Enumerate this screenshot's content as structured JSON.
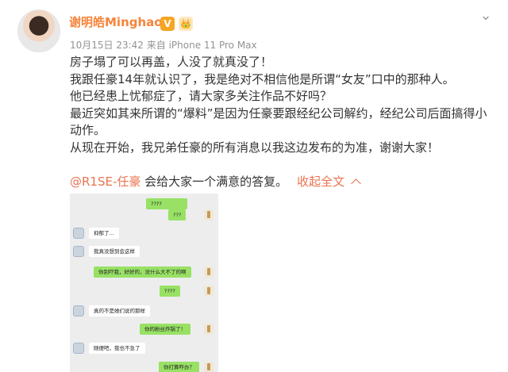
{
  "post": {
    "username": "谢明皓Minghao",
    "badges": [
      "V",
      "👑"
    ],
    "meta": "10月15日 23:42 来自 iPhone 11 Pro Max",
    "lines": [
      "房子塌了可以再盖，人没了就真没了！",
      "我跟任豪14年就认识了，我是绝对不相信他是所谓“女友”口中的那种人。",
      "他已经患上忧郁症了，请大家多关注作品不好吗？",
      "最近突如其来所谓的“爆料”是因为任豪要跟经纪公司解约，经纪公司后面搞得小",
      "动作。",
      "从现在开始，我兄弟任豪的所有消息以我这边发布的为准，谢谢大家！"
    ],
    "mention": "@R1SE-任豪",
    "mention_suffix": " 会给大家一个满意的答复。",
    "collapse_label": "收起全文"
  },
  "chat": {
    "messages": [
      {
        "side": "right",
        "text": "????"
      },
      {
        "side": "right",
        "text": "???"
      },
      {
        "side": "left",
        "text": "抑郁了..."
      },
      {
        "side": "left",
        "text": "我真没想到会这样"
      },
      {
        "side": "right",
        "text": "你别吓我，好好的，没什么大不了的啊"
      },
      {
        "side": "right",
        "text": "????"
      },
      {
        "side": "left",
        "text": "真的不是她们说的那样"
      },
      {
        "side": "right",
        "text": "你的粉丝炸锅了！"
      },
      {
        "side": "left",
        "text": "随便吧，我也不急了"
      },
      {
        "side": "right",
        "text": "你打算咋办？"
      }
    ]
  }
}
